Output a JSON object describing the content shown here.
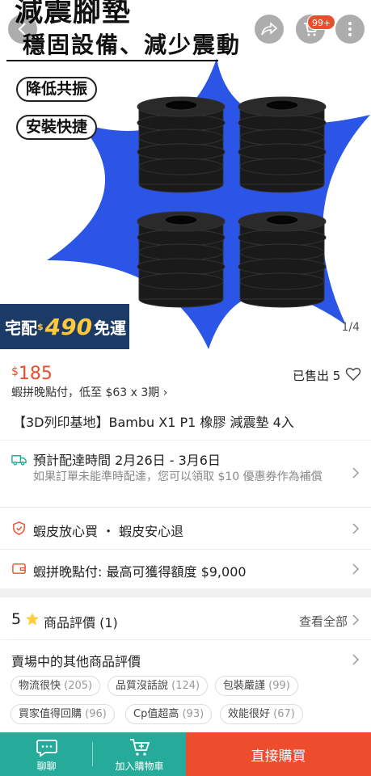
{
  "hero": {
    "title_line1": "減震腳墊",
    "title_line2": "穩固設備、減少震動",
    "pill1": "降低共振",
    "pill2": "安裝快捷",
    "image_counter": "1/4",
    "promo_prefix": "宅配",
    "promo_dollar": "$",
    "promo_amount": "490",
    "promo_suffix": "免運",
    "cart_badge": "99+"
  },
  "product": {
    "currency": "$",
    "price": "185",
    "sold_text": "已售出 5",
    "pay_later": "蝦拼晚點付，低至 $63 x 3期 ›",
    "title": "【3D列印基地】Bambu X1 P1 橡膠 減震墊 4入"
  },
  "shipping": {
    "text": "預計配達時間 2月26日 - 3月6日",
    "sub": "如果訂單未能準時配達，您可以領取 $10 優惠券作為補償"
  },
  "guarantee": {
    "text": "蝦皮放心買 ・ 蝦皮安心退"
  },
  "credit": {
    "text": "蝦拼晚點付: 最高可獲得額度 $9,000"
  },
  "reviews": {
    "rating": "5",
    "label": "商品評價 (1)",
    "see_all": "查看全部"
  },
  "shop_reviews": {
    "title": "賣場中的其他商品評價",
    "tags": [
      {
        "label": "物流很快",
        "count": "(205)"
      },
      {
        "label": "品質沒話說",
        "count": "(124)"
      },
      {
        "label": "包裝嚴謹",
        "count": "(99)"
      },
      {
        "label": "買家值得回購",
        "count": "(96)"
      },
      {
        "label": "Cp值超高",
        "count": "(93)"
      },
      {
        "label": "效能很好",
        "count": "(67)"
      }
    ]
  },
  "bottom": {
    "chat": "聊聊",
    "add_cart": "加入購物車",
    "buy_now": "直接購買"
  },
  "colors": {
    "brand": "#ee4d2d",
    "teal": "#26aa99",
    "blue": "#2b55e6",
    "promo_bg": "#1c3a66"
  }
}
